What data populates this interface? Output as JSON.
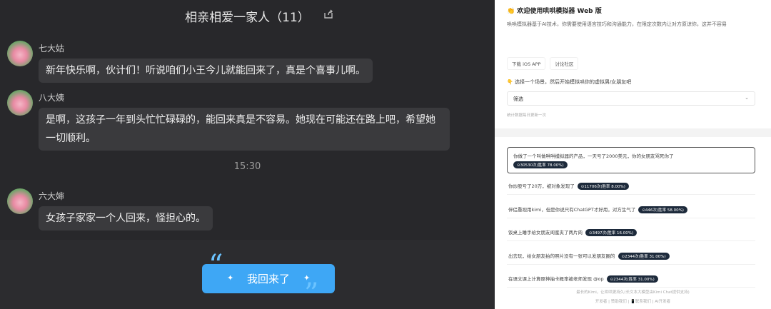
{
  "chat": {
    "title": "相亲相爱一家人（11）",
    "messages": [
      {
        "sender": "七大姑",
        "text": "新年快乐啊，伙计们！听说咱们小王今儿就能回来了，真是个喜事儿啊。"
      },
      {
        "sender": "八大姨",
        "text": "是啊，这孩子一年到头忙忙碌碌的，能回来真是不容易。她现在可能还在路上吧，希望她一切顺利。"
      },
      {
        "sender": "六大婶",
        "text": "女孩子家家一个人回来，怪担心的。"
      }
    ],
    "time": "15:30",
    "banner": "我回来了"
  },
  "web": {
    "title": "👏 欢迎使用哄哄模拟器 Web 版",
    "description": "哄哄模拟器基于AI技术，你需要使用语言技巧和沟通能力，在限定次数内让对方原谅你，这并不容易",
    "buttons": [
      "下载 iOS APP",
      "讨论社区"
    ],
    "prompt": "👇 选择一个场景，然后开始模拟哄你的虚拟男/女朋友吧",
    "select_value": "筛选",
    "stat": "统计数据每日更新一次",
    "scenarios": [
      {
        "text": "你做了一个叫做哄哄模拟器的产品，一天亏了2000美元，你的女朋友骂死你了",
        "badge": "⊙30530次(胜率 78.00%)"
      },
      {
        "text": "你炒股亏了20万，被对象发现了",
        "badge": "⊙11706次(胜率 8.00%)"
      },
      {
        "text": "伴侣重视用kimi，但是你说只有ChatGPT才好用，对方生气了",
        "badge": "⊙446次(胜率 58.00%)"
      },
      {
        "text": "饭桌上睡手给女朋友闺蜜夹了两片肉",
        "badge": "⊙3497次(胜率 16.00%)"
      },
      {
        "text": "出去玩，给女朋友拍的照片没有一张可以发朋友圈的",
        "badge": "⊙2344次(胜率 31.00%)"
      },
      {
        "text": "在语文课上计算原神抽卡概率被老师发现 @op",
        "badge": "⊙2344次(胜率 31.00%)"
      }
    ],
    "footer1": "最长的Kimi，让哄哄更持久(长文本大模型由Kimi Chat提供支持)",
    "footer2": "开发者 | 赞助我们 | 📱联系我们 | AI开发者"
  }
}
